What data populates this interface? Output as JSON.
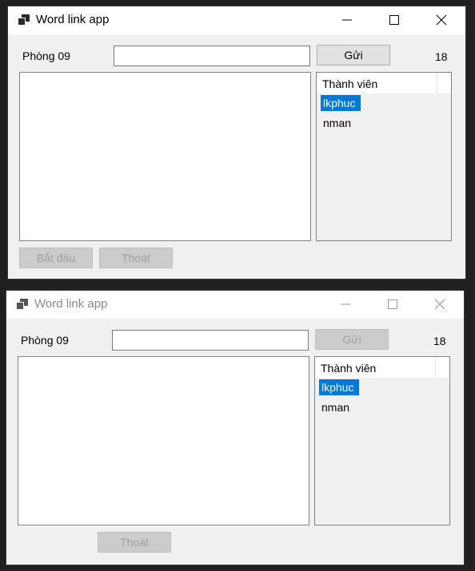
{
  "windows": [
    {
      "title": "Word link app",
      "room_label": "Phòng 09",
      "message_input": "",
      "send_label": "Gửi",
      "count": "18",
      "members_header": "Thành viên",
      "members": [
        "lkphuc",
        "nman"
      ],
      "start_label": "Bắt đầu",
      "quit_label": "Thoát"
    },
    {
      "title": "Word link app",
      "room_label": "Phòng 09",
      "message_input": "",
      "send_label": "Gửi",
      "count": "18",
      "members_header": "Thành viên",
      "members": [
        "lkphuc",
        "nman"
      ],
      "quit_label": "Thoát"
    }
  ],
  "icons": {
    "app": "app-icon",
    "minimize": "minimize-icon",
    "maximize": "maximize-icon",
    "close": "close-icon"
  },
  "colors": {
    "selection": "#0078d7",
    "window_bg": "#f0f0f0"
  }
}
